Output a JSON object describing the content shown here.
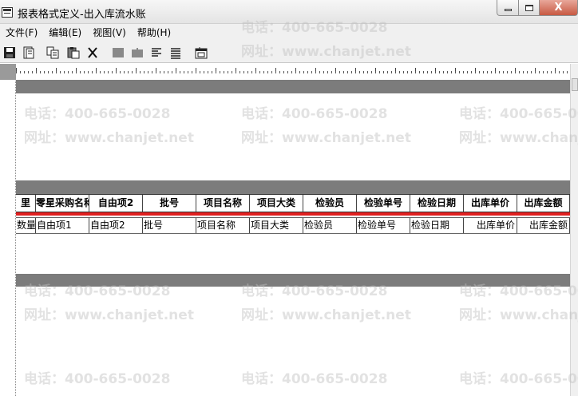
{
  "window": {
    "title": "报表格式定义-出入库流水账",
    "close_label": "X"
  },
  "menu": [
    {
      "label": "文件(F)"
    },
    {
      "label": "编辑(E)"
    },
    {
      "label": "视图(V)"
    },
    {
      "label": "帮助(H)"
    }
  ],
  "toolbar": {
    "icons": [
      "save-icon",
      "page-setup-icon",
      "copy-icon",
      "paste-icon",
      "cut-icon",
      "column-layout-icon",
      "row-layout-icon",
      "align-left-icon",
      "align-justify-icon",
      "properties-icon"
    ]
  },
  "table": {
    "headers": [
      "里",
      "零星采购名称",
      "自由项2",
      "批号",
      "项目名称",
      "项目大类",
      "检验员",
      "检验单号",
      "检验日期",
      "出库单价",
      "出库金额"
    ],
    "detail": [
      "数量",
      "自由项1",
      "自由项2",
      "批号",
      "项目名称",
      "项目大类",
      "检验员",
      "检验单号",
      "检验日期",
      "出库单价",
      "出库金额"
    ]
  },
  "watermark": {
    "phone": "电话：400-665-0028",
    "site": "网址：www.chanjet.net"
  }
}
